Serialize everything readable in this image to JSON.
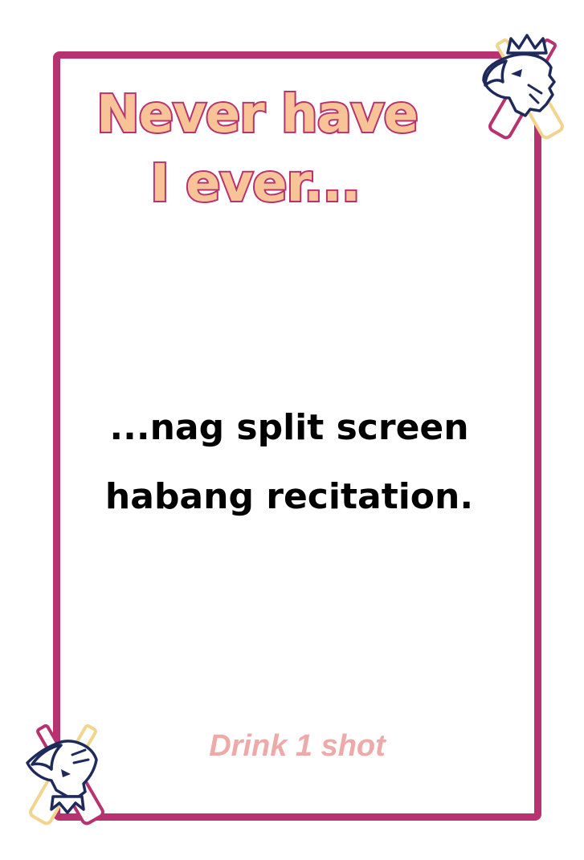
{
  "card": {
    "title_line1": "Never have",
    "title_line2": "I ever...",
    "prompt_line1": "...nag split screen",
    "prompt_line2": "habang recitation.",
    "penalty": "Drink 1 shot"
  },
  "colors": {
    "frame": "#b6336f",
    "title_fill": "#f7c397",
    "penalty": "#eeaaa8",
    "bottle_gold": "#f3d48e",
    "bottle_magenta": "#b6336f",
    "eagle_navy": "#1f2a5c"
  },
  "icons": {
    "top_right": "eagle-crossed-bottles-icon",
    "bottom_left": "eagle-crossed-bottles-icon"
  }
}
